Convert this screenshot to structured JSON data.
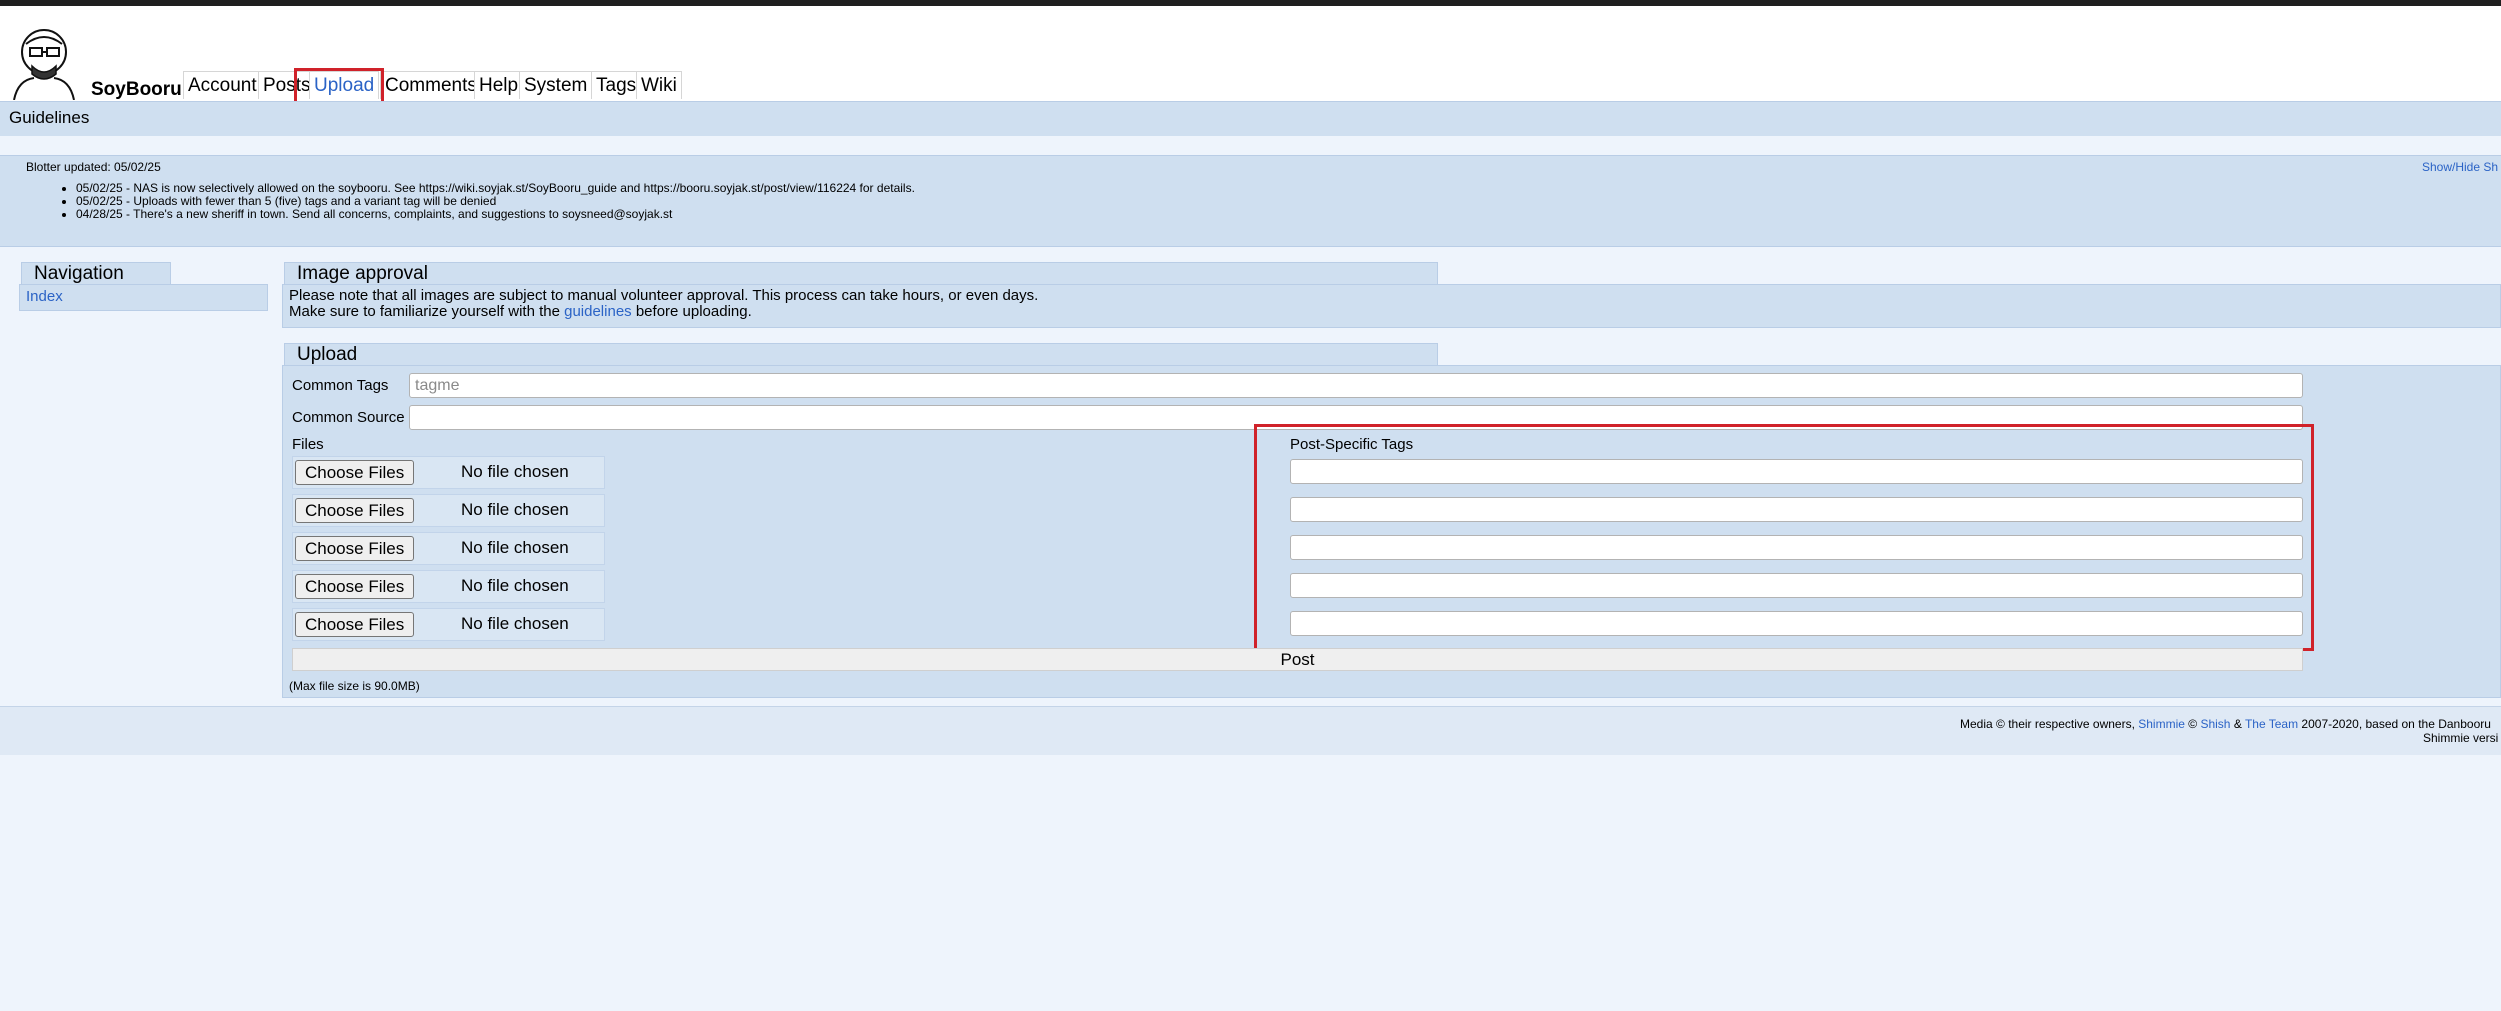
{
  "header": {
    "site_title": "SoyBooru",
    "nav": [
      "Account",
      "Posts",
      "Upload",
      "Comments",
      "Help",
      "System",
      "Tags",
      "Wiki"
    ],
    "active": "Upload"
  },
  "subnav": {
    "guidelines": "Guidelines"
  },
  "blotter": {
    "updated": "Blotter updated: 05/02/25",
    "toggle": "Show/Hide Sh",
    "entries": [
      "05/02/25 - NAS is now selectively allowed on the soybooru. See https://wiki.soyjak.st/SoyBooru_guide and https://booru.soyjak.st/post/view/116224 for details.",
      "05/02/25 - Uploads with fewer than 5 (five) tags and a variant tag will be denied",
      "04/28/25 - There's a new sheriff in town. Send all concerns, complaints, and suggestions to soysneed@soyjak.st"
    ]
  },
  "navigation": {
    "title": "Navigation",
    "index": "Index"
  },
  "approval": {
    "title": "Image approval",
    "line1": "Please note that all images are subject to manual volunteer approval. This process can take hours, or even days.",
    "line2_pre": "Make sure to familiarize yourself with the ",
    "line2_link": "guidelines",
    "line2_post": " before uploading."
  },
  "upload": {
    "title": "Upload",
    "common_tags_label": "Common Tags",
    "common_tags_placeholder": "tagme",
    "common_source_label": "Common Source",
    "files_label": "Files",
    "post_tags_label": "Post-Specific Tags",
    "choose_files": "Choose Files",
    "no_file": "No file chosen",
    "post_button": "Post",
    "max_size": "(Max file size is 90.0MB)"
  },
  "footer": {
    "pre": "Media © their respective owners, ",
    "shimmie": "Shimmie",
    "copy": " © ",
    "shish": "Shish",
    "amp": " & ",
    "team": "The Team",
    "post": " 2007-2020, based on the Danbooru",
    "version": "Shimmie versi"
  },
  "colors": {
    "accent": "#2b63c6",
    "highlight": "#d0222a",
    "panel": "#cfdff0"
  }
}
